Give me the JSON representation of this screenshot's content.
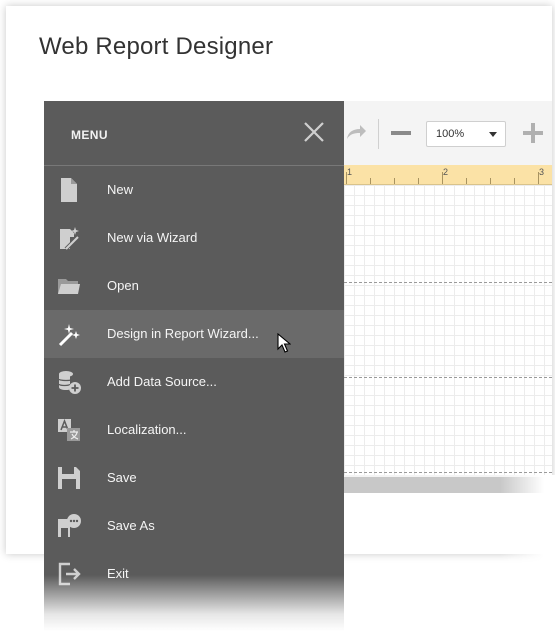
{
  "page": {
    "title": "Web Report Designer"
  },
  "toolbar": {
    "zoom_value": "100%",
    "redo_icon": "redo-icon",
    "zoom_out_icon": "zoom-out-icon",
    "zoom_in_icon": "zoom-in-icon"
  },
  "ruler": {
    "ticks": [
      "1",
      "2",
      "3"
    ]
  },
  "menu": {
    "title": "MENU",
    "close_icon": "close-icon",
    "items": [
      {
        "label": "New",
        "icon": "new-document-icon"
      },
      {
        "label": "New via Wizard",
        "icon": "wizard-wand-icon"
      },
      {
        "label": "Open",
        "icon": "folder-icon"
      },
      {
        "label": "Design in Report Wizard...",
        "icon": "magic-wand-icon",
        "active": true
      },
      {
        "label": "Add Data Source...",
        "icon": "add-database-icon"
      },
      {
        "label": "Localization...",
        "icon": "localization-icon"
      },
      {
        "label": "Save",
        "icon": "save-icon"
      },
      {
        "label": "Save As",
        "icon": "save-as-icon"
      },
      {
        "label": "Exit",
        "icon": "exit-icon"
      }
    ]
  },
  "colors": {
    "menu_bg": "#5b5b5b",
    "menu_active": "#6a6a6a",
    "ruler_bg": "#fbe2a6",
    "icon": "#cfcfcf"
  }
}
